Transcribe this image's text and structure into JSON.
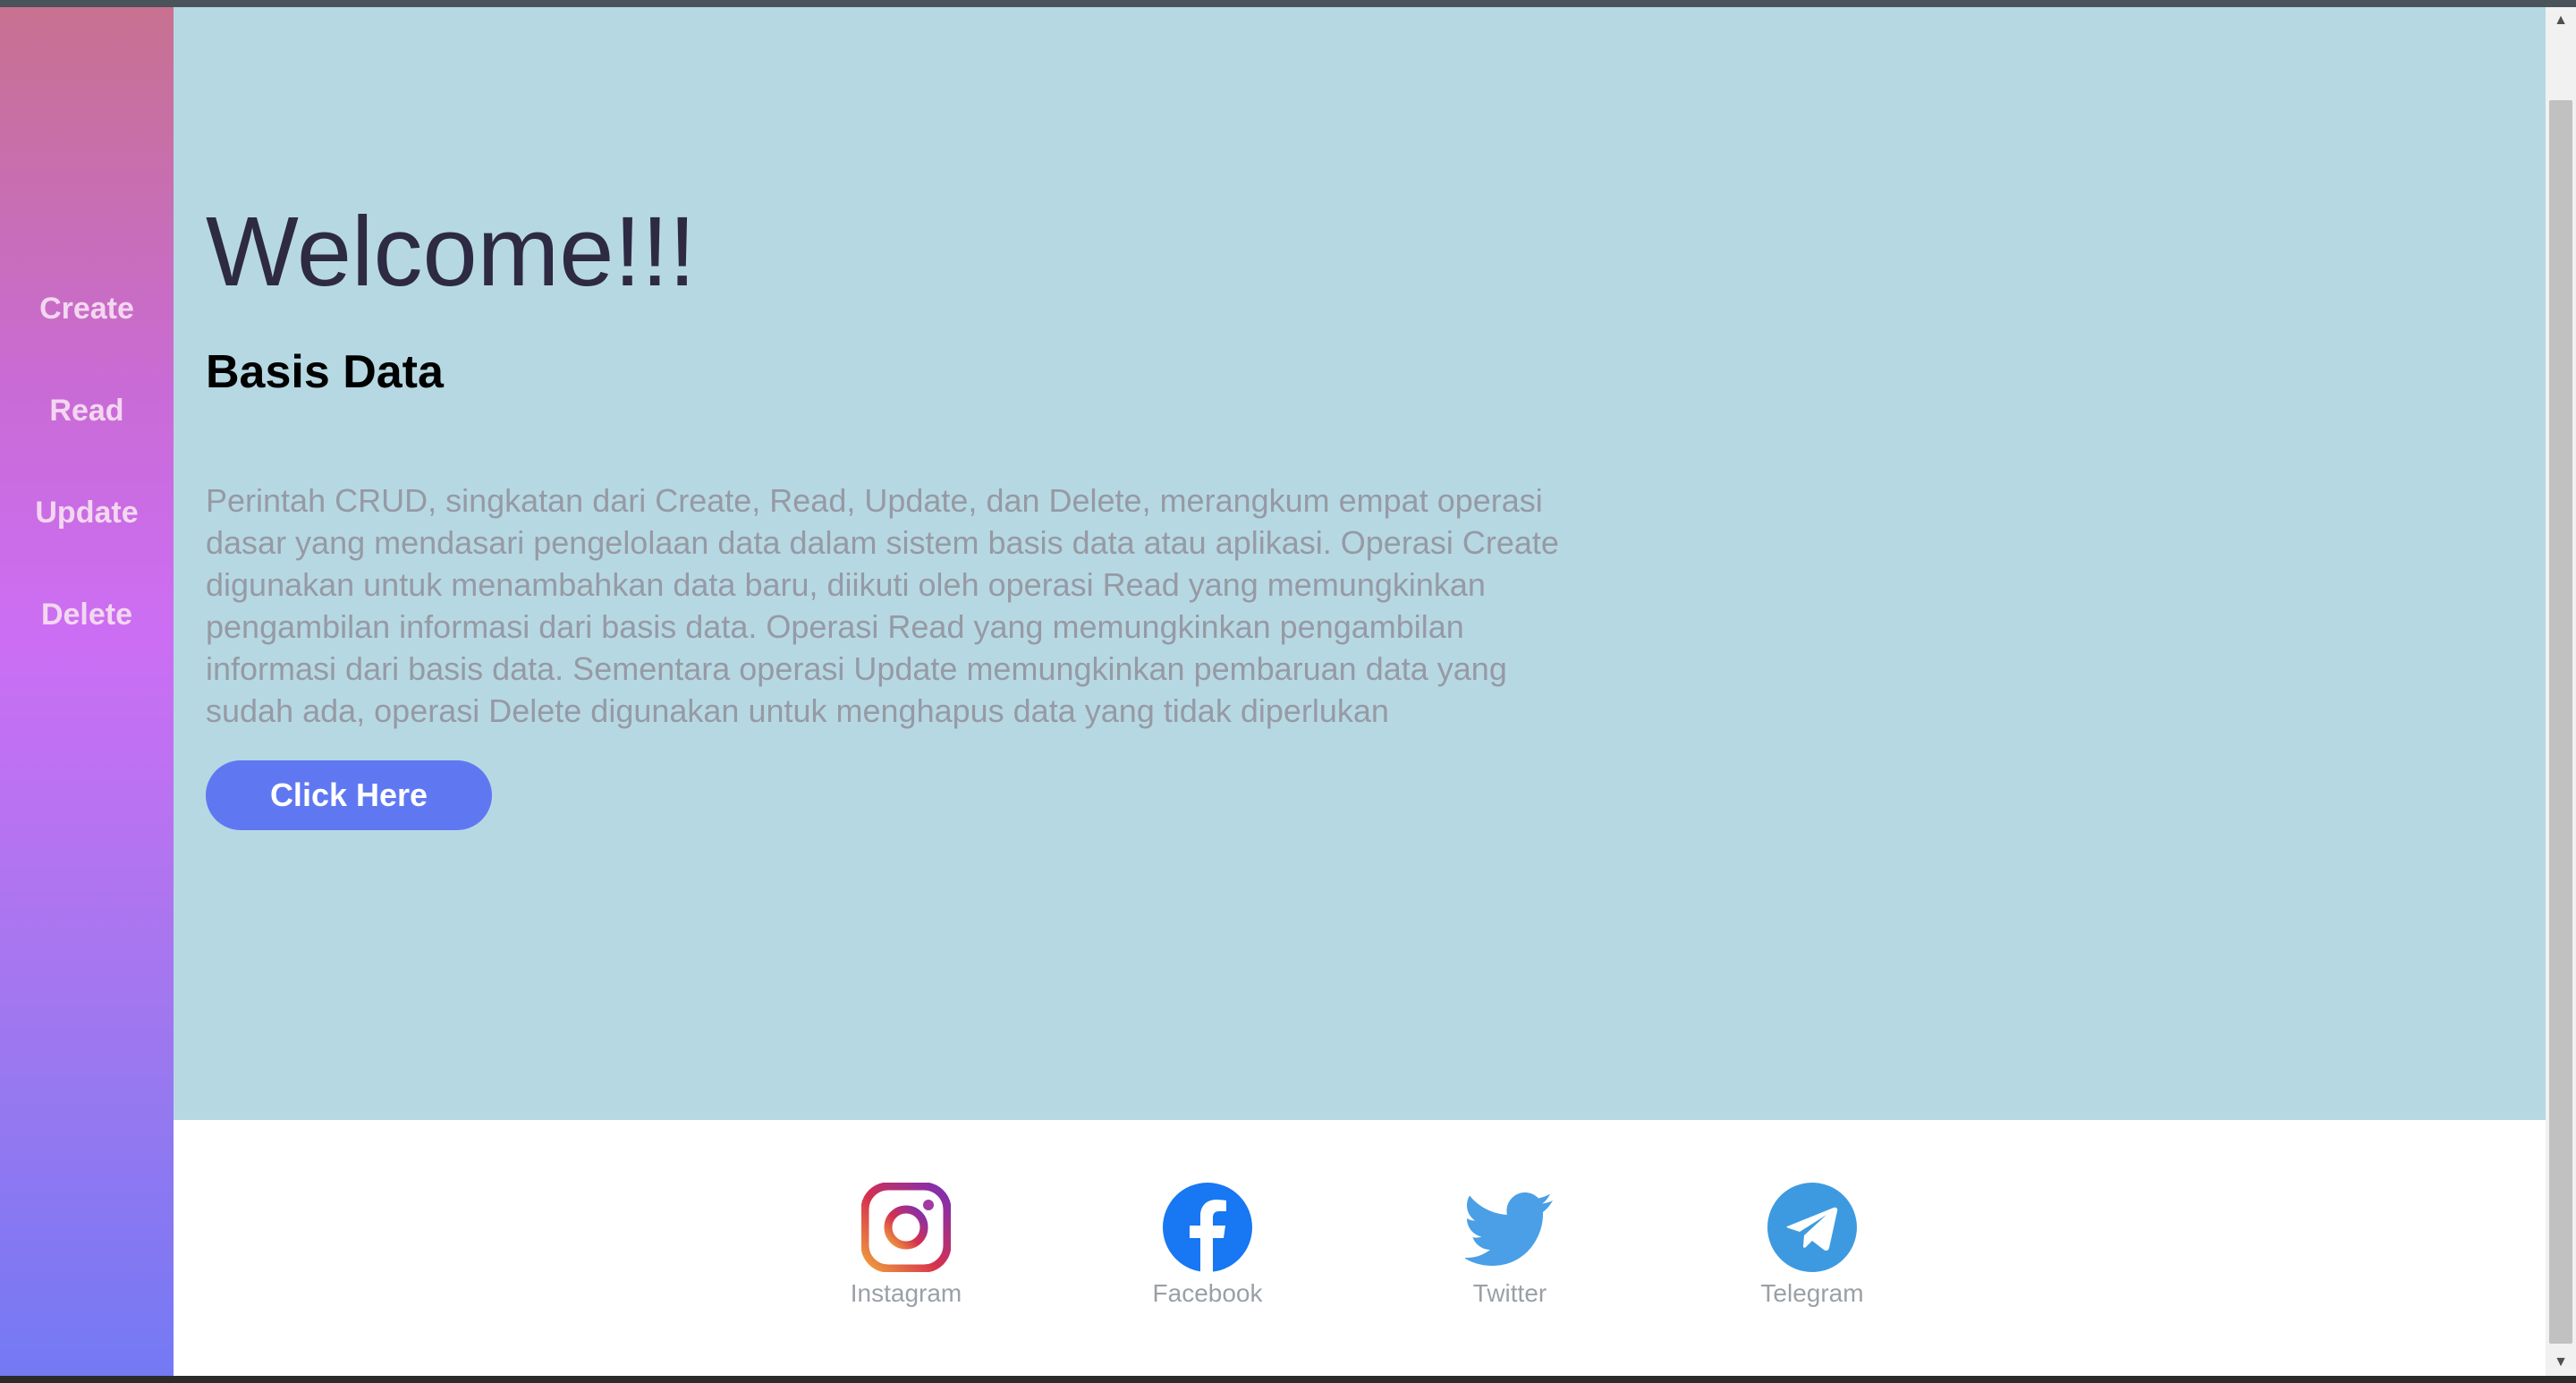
{
  "sidebar": {
    "items": [
      {
        "label": "Create"
      },
      {
        "label": "Read"
      },
      {
        "label": "Update"
      },
      {
        "label": "Delete"
      }
    ]
  },
  "hero": {
    "title": "Welcome!!!",
    "subtitle": "Basis Data",
    "paragraph": "Perintah CRUD, singkatan dari Create, Read, Update, dan Delete, merangkum empat operasi dasar yang mendasari pengelolaan data dalam sistem basis data atau aplikasi. Operasi Create digunakan untuk menambahkan data baru, diikuti oleh operasi Read yang memungkinkan pengambilan informasi dari basis data. Operasi Read yang memungkinkan pengambilan informasi dari basis data. Sementara operasi Update memungkinkan pembaruan data yang sudah ada, operasi Delete digunakan untuk menghapus data yang tidak diperlukan",
    "button_label": "Click Here"
  },
  "footer": {
    "social": [
      {
        "label": "Instagram",
        "icon": "instagram-icon"
      },
      {
        "label": "Facebook",
        "icon": "facebook-icon"
      },
      {
        "label": "Twitter",
        "icon": "twitter-icon"
      },
      {
        "label": "Telegram",
        "icon": "telegram-icon"
      }
    ]
  },
  "colors": {
    "main_background": "#b6d8e3",
    "button": "#5f78f2",
    "sidebar_gradient": [
      "#c87190",
      "#cc6ef4",
      "#7479f4"
    ]
  }
}
